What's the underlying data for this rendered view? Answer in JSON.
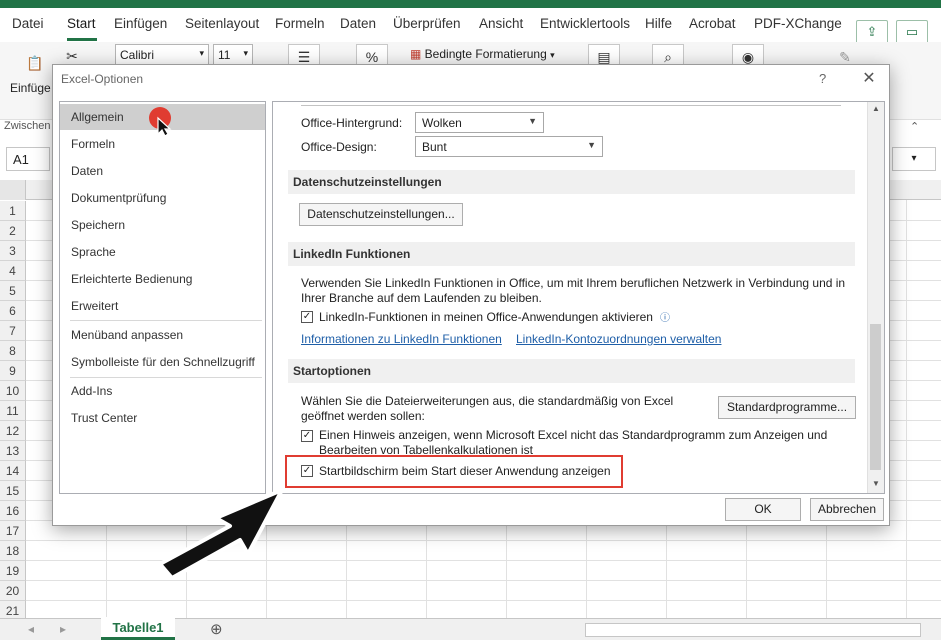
{
  "ribbon": {
    "tabs": [
      "Datei",
      "Start",
      "Einfügen",
      "Seitenlayout",
      "Formeln",
      "Daten",
      "Überprüfen",
      "Ansicht",
      "Entwicklertools",
      "Hilfe",
      "Acrobat",
      "PDF-XChange"
    ],
    "paste_label": "Einfüge",
    "clipboard_group": "Zwischen",
    "font_name": "Calibri",
    "font_size": "11",
    "conditional_format": "Bedingte Formatierung",
    "namebox": "A1"
  },
  "grid": {
    "rows": [
      "1",
      "2",
      "3",
      "4",
      "5",
      "6",
      "7",
      "8",
      "9",
      "10",
      "11",
      "12",
      "13",
      "14",
      "15",
      "16",
      "17",
      "18",
      "19",
      "20",
      "21"
    ],
    "sheet_tab": "Tabelle1",
    "add_sheet": "⊕"
  },
  "dialog": {
    "title": "Excel-Optionen",
    "help": "?",
    "close": "✕",
    "nav": {
      "group1": [
        "Allgemein",
        "Formeln",
        "Daten",
        "Dokumentprüfung",
        "Speichern",
        "Sprache",
        "Erleichterte Bedienung",
        "Erweitert"
      ],
      "group2": [
        "Menüband anpassen",
        "Symbolleiste für den Schnellzugriff"
      ],
      "group3": [
        "Add-Ins",
        "Trust Center"
      ]
    },
    "office_bg_label": "Office-Hintergrund:",
    "office_bg_value": "Wolken",
    "office_design_label": "Office-Design:",
    "office_design_value": "Bunt",
    "privacy": {
      "header": "Datenschutzeinstellungen",
      "button": "Datenschutzeinstellungen..."
    },
    "linkedin": {
      "header": "LinkedIn Funktionen",
      "desc1": "Verwenden Sie LinkedIn Funktionen in Office, um mit Ihrem beruflichen Netzwerk in Verbindung und in",
      "desc2": "Ihrer Branche auf dem Laufenden zu bleiben.",
      "checkbox_label": "LinkedIn-Funktionen in meinen Office-Anwendungen aktivieren",
      "checkbox_checked": true,
      "link1": "Informationen zu LinkedIn Funktionen",
      "link2": "LinkedIn-Kontozuordnungen verwalten"
    },
    "startup": {
      "header": "Startoptionen",
      "desc1": "Wählen Sie die Dateierweiterungen aus, die standardmäßig von Excel",
      "desc2": "geöffnet werden sollen:",
      "default_programs_btn": "Standardprogramme...",
      "hint_label1": "Einen Hinweis anzeigen, wenn Microsoft Excel nicht das Standardprogramm zum Anzeigen und",
      "hint_label2": "Bearbeiten von Tabellenkalkulationen ist",
      "hint_checked": true,
      "splash_label": "Startbildschirm beim Start dieser Anwendung anzeigen",
      "splash_checked": true
    },
    "ok": "OK",
    "cancel": "Abbrechen"
  },
  "colors": {
    "excel_green": "#217346",
    "highlight_red": "#e03c31",
    "link_blue": "#1f5fa8"
  }
}
